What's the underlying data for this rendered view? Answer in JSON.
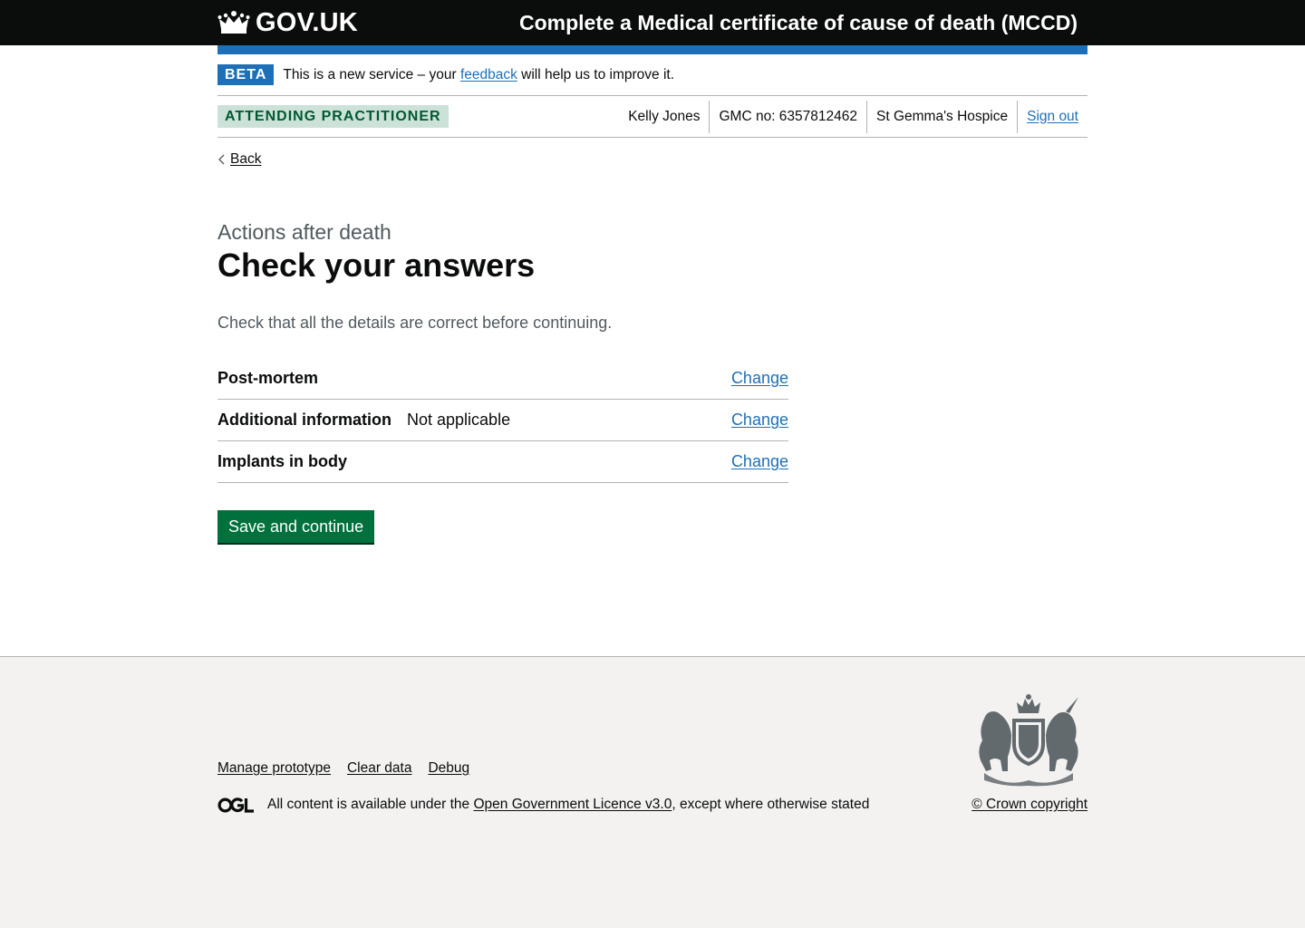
{
  "header": {
    "logo_text": "GOV.UK",
    "logo_icon": "crown-icon",
    "service_name": "Complete a Medical certificate of cause of death (MCCD)"
  },
  "phase_banner": {
    "tag": "BETA",
    "text_before": "This is a new service – your",
    "link": "feedback",
    "text_after": "will help us to improve it."
  },
  "role_bar": {
    "role": "ATTENDING PRACTITIONER",
    "user_name": "Kelly Jones",
    "gmc": "GMC no: 6357812462",
    "organisation": "St Gemma's Hospice",
    "sign_out": "Sign out"
  },
  "back_link": {
    "label": "Back",
    "icon": "chevron-left-icon"
  },
  "main": {
    "caption": "Actions after death",
    "title": "Check your answers",
    "lede": "Check that all the details are correct before continuing.",
    "rows": [
      {
        "key": "Post-mortem",
        "value": "",
        "action": "Change"
      },
      {
        "key": "Additional information",
        "value": "Not applicable",
        "action": "Change"
      },
      {
        "key": "Implants in body",
        "value": "",
        "action": "Change"
      }
    ],
    "submit": "Save and continue"
  },
  "footer": {
    "links": [
      "Manage prototype",
      "Clear data",
      "Debug"
    ],
    "licence_before": "All content is available under the",
    "licence_link": "Open Government Licence v3.0",
    "licence_after": ", except where otherwise stated",
    "copyright": "© Crown copyright",
    "ogl_icon": "ogl-logo-icon",
    "crest_icon": "royal-coat-of-arms-icon"
  },
  "colors": {
    "header_bg": "#0b0c0c",
    "brand_blue": "#1d70b8",
    "button_green": "#00703c",
    "role_tag_bg": "#cce2d8",
    "role_tag_text": "#005a30",
    "footer_bg": "#f3f2f1"
  }
}
